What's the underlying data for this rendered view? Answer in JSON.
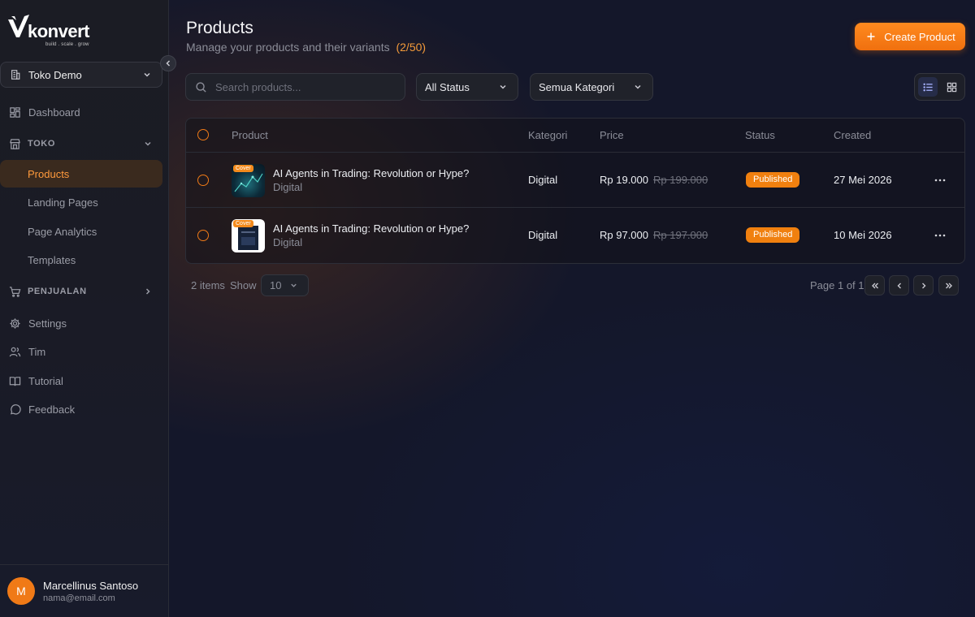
{
  "sidebar": {
    "logo": {
      "word": "konvert",
      "tagline": "build . scale . grow"
    },
    "store": {
      "name": "Toko Demo"
    },
    "nav": {
      "dashboard": "Dashboard",
      "toko_section": "TOKO",
      "products": "Products",
      "landing_pages": "Landing Pages",
      "page_analytics": "Page Analytics",
      "templates": "Templates",
      "penjualan_section": "PENJUALAN",
      "settings": "Settings",
      "tim": "Tim",
      "tutorial": "Tutorial",
      "feedback": "Feedback"
    },
    "user": {
      "initial": "M",
      "name": "Marcellinus Santoso",
      "email": "nama@email.com"
    }
  },
  "header": {
    "title": "Products",
    "subtitle": "Manage your products and their variants",
    "count": "(2/50)",
    "create_label": "Create Product"
  },
  "filters": {
    "search_placeholder": "Search products...",
    "status": "All Status",
    "category": "Semua Kategori"
  },
  "table": {
    "columns": {
      "product": "Product",
      "kategori": "Kategori",
      "price": "Price",
      "status": "Status",
      "created": "Created"
    },
    "rows": [
      {
        "name": "AI Agents in Trading: Revolution or Hype?",
        "type": "Digital",
        "cover_tag": "Cover",
        "kategori": "Digital",
        "price": "Rp 19.000",
        "old_price": "Rp 199.000",
        "status": "Published",
        "created": "27 Mei 2026"
      },
      {
        "name": "AI Agents in Trading: Revolution or Hype?",
        "type": "Digital",
        "cover_tag": "Cover",
        "kategori": "Digital",
        "price": "Rp 97.000",
        "old_price": "Rp 197.000",
        "status": "Published",
        "created": "10 Mei 2026"
      }
    ]
  },
  "footer": {
    "items": "2 items",
    "show": "Show",
    "page_size": "10",
    "page_info": "Page 1 of 1"
  },
  "colors": {
    "accent": "#f07a17",
    "badge": "#f0800f",
    "background": "#14172a"
  }
}
